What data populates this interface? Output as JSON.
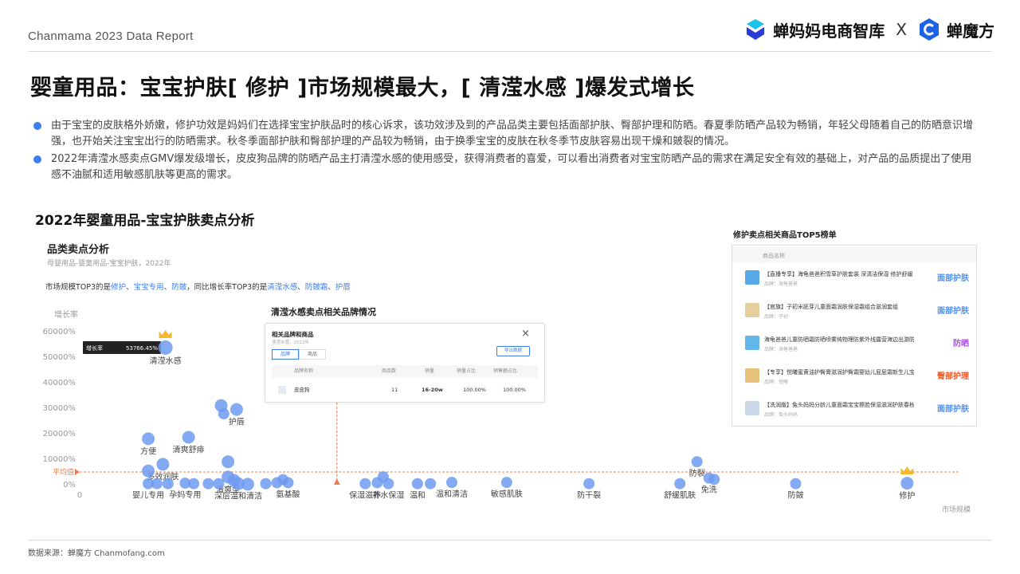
{
  "header": {
    "report_label": "Chanmama 2023 Data Report",
    "brand_left": "蝉妈妈电商智库",
    "brand_sep": "X",
    "brand_right": "蝉魔方"
  },
  "headline": "婴童用品：宝宝护肤[ 修护 ]市场规模最大，[ 清滢水感 ]爆发式增长",
  "bullets": [
    "由于宝宝的皮肤格外娇嫩，修护功效是妈妈们在选择宝宝护肤品时的核心诉求，该功效涉及到的产品品类主要包括面部护肤、臀部护理和防晒。春夏季防晒产品较为畅销，年轻父母随着自己的防晒意识增强，也开始关注宝宝出行的防晒需求。秋冬季面部护肤和臀部护理的产品较为畅销，由于换季宝宝的皮肤在秋冬季节皮肤容易出现干燥和皴裂的情况。",
    "2022年清滢水感卖点GMV爆发级增长，皮皮狗品牌的防晒产品主打清滢水感的使用感受，获得消费者的喜爱，可以看出消费者对宝宝防晒产品的需求在满足安全有效的基础上，对产品的品质提出了使用感不油腻和适用敏感肌肤等更高的需求。"
  ],
  "section_title": "2022年婴童用品-宝宝护肤卖点分析",
  "panel": {
    "title": "品类卖点分析",
    "subtitle": "母婴用品-婴童用品-宝宝护肤，2022年",
    "note_prefix": "市场规模TOP3的是",
    "note_top3": [
      "修护",
      "宝宝专用",
      "防皴"
    ],
    "note_mid": "，同比增长率TOP3的是",
    "note_growth3": [
      "清滢水感",
      "防皴霜",
      "护唇"
    ],
    "note_sep": "、"
  },
  "chart_data": {
    "type": "scatter",
    "ylabel": "增长率",
    "xlabel": "市场规模",
    "y_ticks": [
      "60000%",
      "50000%",
      "40000%",
      "30000%",
      "20000%",
      "10000%",
      "0%"
    ],
    "y_tick_values": [
      60000,
      50000,
      40000,
      30000,
      20000,
      10000,
      0
    ],
    "x_origin_label": "0",
    "ylim": [
      0,
      60000
    ],
    "xlim": [
      0,
      100
    ],
    "average_label": "平均值",
    "average_y": 5000,
    "average_x": 30,
    "tooltip": {
      "label": "增长率",
      "value": "53766.45%"
    },
    "points": [
      {
        "label": "清滢水感",
        "x": 10,
        "y": 53766,
        "r": 9,
        "crown": true
      },
      {
        "label": "",
        "x": 16.5,
        "y": 31000,
        "r": 8
      },
      {
        "label": "",
        "x": 16.8,
        "y": 27800,
        "r": 7
      },
      {
        "label": "护唇",
        "x": 18.3,
        "y": 29500,
        "r": 8
      },
      {
        "label": "方便",
        "x": 8,
        "y": 18000,
        "r": 8
      },
      {
        "label": "清爽舒痱",
        "x": 12.7,
        "y": 18600,
        "r": 8
      },
      {
        "label": "",
        "x": 17.3,
        "y": 9000,
        "r": 8
      },
      {
        "label": "多效润肤",
        "x": 9.7,
        "y": 8000,
        "r": 8
      },
      {
        "label": "",
        "x": 8,
        "y": 5400,
        "r": 8
      },
      {
        "label": "清爽型",
        "x": 17.3,
        "y": 3000,
        "r": 8
      },
      {
        "label": "",
        "x": 18,
        "y": 1700,
        "r": 8
      },
      {
        "label": "婴儿专用",
        "x": 8,
        "y": 400,
        "r": 7
      },
      {
        "label": "",
        "x": 9,
        "y": 400,
        "r": 7
      },
      {
        "label": "",
        "x": 10.3,
        "y": 400,
        "r": 7
      },
      {
        "label": "孕妈专用",
        "x": 12.3,
        "y": 600,
        "r": 7
      },
      {
        "label": "",
        "x": 13.3,
        "y": 400,
        "r": 7
      },
      {
        "label": "",
        "x": 15,
        "y": 400,
        "r": 7
      },
      {
        "label": "",
        "x": 16.2,
        "y": 400,
        "r": 7
      },
      {
        "label": "深层温和清洁",
        "x": 18.5,
        "y": 400,
        "r": 8
      },
      {
        "label": "",
        "x": 19.6,
        "y": 200,
        "r": 8
      },
      {
        "label": "",
        "x": 21.7,
        "y": 400,
        "r": 7
      },
      {
        "label": "",
        "x": 23,
        "y": 800,
        "r": 7
      },
      {
        "label": "氨基酸",
        "x": 24.3,
        "y": 800,
        "r": 7
      },
      {
        "label": "",
        "x": 23.7,
        "y": 2000,
        "r": 7
      },
      {
        "label": "保湿滋养",
        "x": 33.3,
        "y": 400,
        "r": 7
      },
      {
        "label": "",
        "x": 34.7,
        "y": 800,
        "r": 7
      },
      {
        "label": "",
        "x": 35.4,
        "y": 3100,
        "r": 7
      },
      {
        "label": "补水保湿",
        "x": 36,
        "y": 400,
        "r": 7
      },
      {
        "label": "温和",
        "x": 39.4,
        "y": 400,
        "r": 7
      },
      {
        "label": "",
        "x": 40.9,
        "y": 400,
        "r": 7
      },
      {
        "label": "温和清洁",
        "x": 43.4,
        "y": 900,
        "r": 7
      },
      {
        "label": "敏感肌肤",
        "x": 49.8,
        "y": 900,
        "r": 7
      },
      {
        "label": "防干裂",
        "x": 59.4,
        "y": 400,
        "r": 7
      },
      {
        "label": "舒缓肌肤",
        "x": 70,
        "y": 400,
        "r": 7
      },
      {
        "label": "防裂",
        "x": 72,
        "y": 9000,
        "r": 7
      },
      {
        "label": "免洗",
        "x": 73.4,
        "y": 2600,
        "r": 7
      },
      {
        "label": "",
        "x": 74,
        "y": 2100,
        "r": 7
      },
      {
        "label": "防皴",
        "x": 83.5,
        "y": 400,
        "r": 7
      },
      {
        "label": "修护",
        "x": 96.5,
        "y": 600,
        "r": 8,
        "crown": true
      }
    ]
  },
  "popup": {
    "section_title": "清滢水感卖点相关品牌情况",
    "title": "相关品牌和商品",
    "subtitle": "清滢水感，2022年",
    "close": "×",
    "tabs": [
      "品牌",
      "商品"
    ],
    "export": "导出数据",
    "columns": [
      "品牌名称",
      "商品数",
      "销量",
      "销量占比",
      "销售额占比"
    ],
    "row": {
      "brand": "皮皮狗",
      "items": "11",
      "sales": "16-20w",
      "sales_share": "100.00%",
      "gmv_share": "100.00%"
    }
  },
  "ranking": {
    "title": "修护卖点相关商品TOP5榜单",
    "column": "商品名称",
    "brand_prefix": "品牌：",
    "items": [
      {
        "name": "【直播专享】海龟爸爸积雪草护肤套装 深清洁保湿 修护舒缓 A",
        "brand": "海龟爸爸",
        "tag": "面部护肤",
        "tag_color": "#4f8ef7",
        "thumb_color": "#57a9e8"
      },
      {
        "name": "【官旗】子初米胚芽儿童面霜润肤保湿霜组合滋润套组",
        "brand": "子初",
        "tag": "面部护肤",
        "tag_color": "#4f8ef7",
        "thumb_color": "#e5cf9e"
      },
      {
        "name": "海龟爸爸儿童防晒霜防晒喷雾纯物理防紫外线露营海边出游防晒乳",
        "brand": "海龟爸爸",
        "tag": "防晒",
        "tag_color": "#b04de8",
        "thumb_color": "#64b5ea"
      },
      {
        "name": "【专享】悦曦蜜黄油护臀膏滋润护臀霜婴幼儿屁屁霜新生儿宝宝膏",
        "brand": "悦曦",
        "tag": "臀部护理",
        "tag_color": "#f05a28",
        "thumb_color": "#e7c27a"
      },
      {
        "name": "【洗润版】兔头妈妈分龄儿童面霜宝宝擦脸保湿滋润护肤春秋防皴",
        "brand": "兔头妈妈",
        "tag": "面部护肤",
        "tag_color": "#4f8ef7",
        "thumb_color": "#c9d7e6"
      }
    ]
  },
  "footer": {
    "source": "数据来源：蝉魔方 Chanmofang.com"
  },
  "colors": {
    "accent": "#3e7ef0",
    "dot": "#6d9bf1",
    "average_line": "#ef7d52",
    "crown": "#f5b92c"
  }
}
